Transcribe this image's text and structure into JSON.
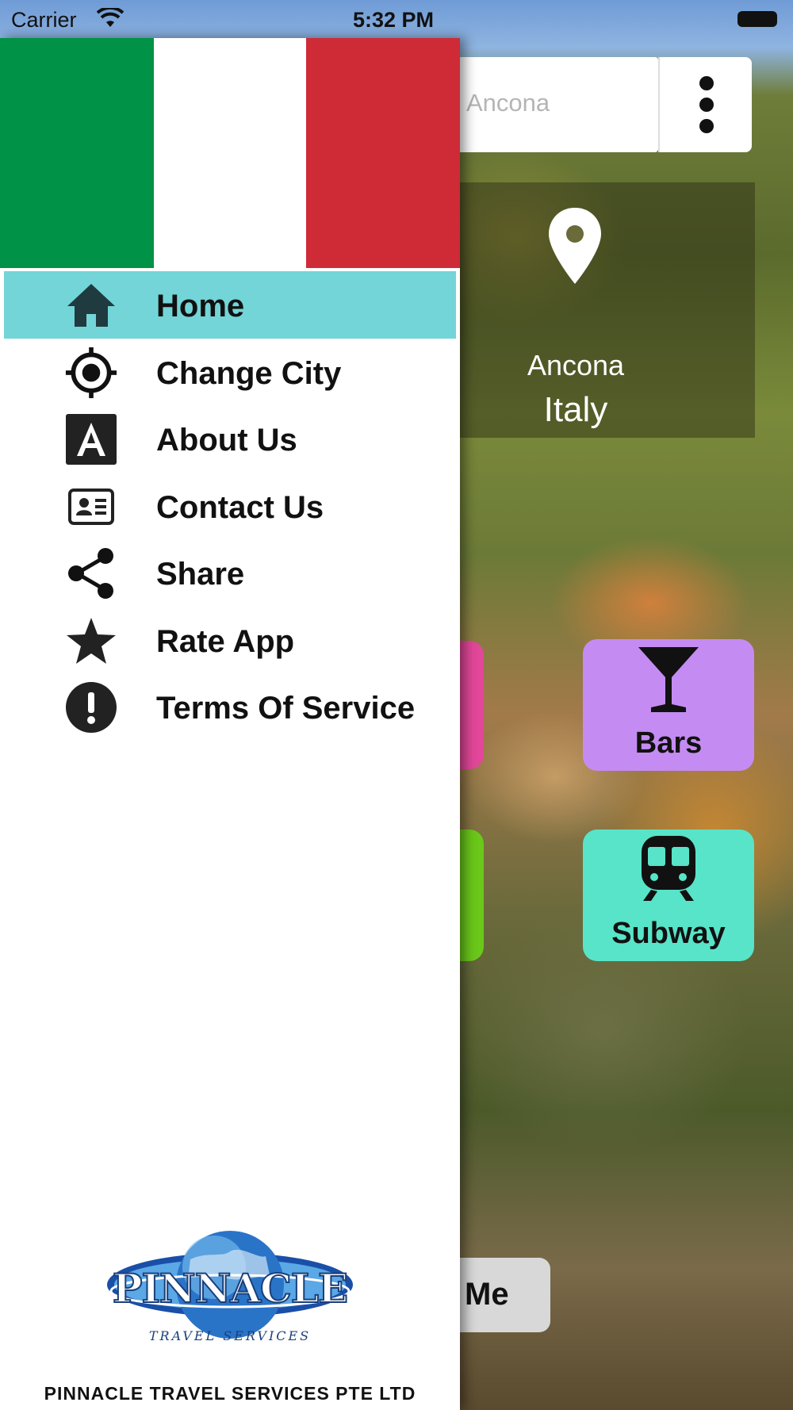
{
  "status_bar": {
    "carrier": "Carrier",
    "time": "5:32 PM"
  },
  "search": {
    "text": "Ancona"
  },
  "location": {
    "city": "Ancona",
    "country": "Italy"
  },
  "tiles": [
    {
      "label": "Bars",
      "icon": "cocktail-icon",
      "color": "#c48cf2"
    },
    {
      "label": "Subway",
      "icon": "train-icon",
      "color": "#57e4c8"
    }
  ],
  "me_button": {
    "label": "Me"
  },
  "drawer": {
    "flag_colors": [
      "#009246",
      "#ffffff",
      "#ce2b37"
    ],
    "active_color": "#73d5d7",
    "menu": [
      {
        "label": "Home",
        "icon": "home-icon",
        "active": true
      },
      {
        "label": "Change City",
        "icon": "target-icon",
        "active": false
      },
      {
        "label": "About Us",
        "icon": "about-icon",
        "active": false
      },
      {
        "label": "Contact Us",
        "icon": "contact-card-icon",
        "active": false
      },
      {
        "label": "Share",
        "icon": "share-icon",
        "active": false
      },
      {
        "label": "Rate App",
        "icon": "star-icon",
        "active": false
      },
      {
        "label": "Terms Of Service",
        "icon": "alert-icon",
        "active": false
      }
    ],
    "logo_text": "PINNACLE",
    "logo_subtext": "TRAVEL SERVICES",
    "company_name": "PINNACLE TRAVEL SERVICES PTE LTD"
  }
}
